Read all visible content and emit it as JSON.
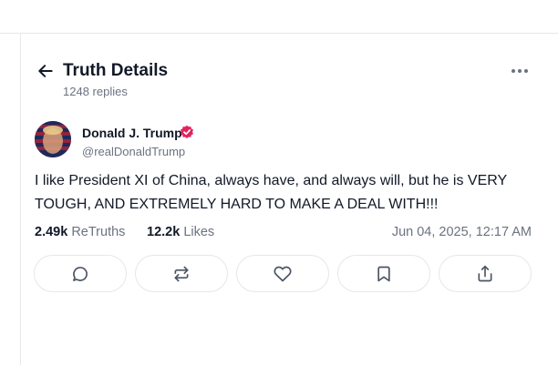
{
  "header": {
    "title": "Truth Details",
    "replies_count": "1248 replies",
    "back_icon": "arrow-left-icon",
    "more_icon": "more-horizontal-icon"
  },
  "post": {
    "author_name": "Donald J. Trump",
    "handle": "@realDonaldTrump",
    "verified_color": "#e0245e",
    "text": "I like President XI of China, always have, and always will, but he is VERY TOUGH, AND EXTREMELY HARD TO MAKE A DEAL WITH!!!",
    "retruths_count": "2.49k",
    "retruths_label": "ReTruths",
    "likes_count": "12.2k",
    "likes_label": "Likes",
    "timestamp": "Jun 04, 2025, 12:17 AM"
  },
  "actions": [
    {
      "icon": "reply-icon"
    },
    {
      "icon": "retruth-icon"
    },
    {
      "icon": "like-icon"
    },
    {
      "icon": "bookmark-icon"
    },
    {
      "icon": "share-icon"
    }
  ],
  "colors": {
    "border": "#e5e7eb",
    "secondary_text": "#6b7280",
    "primary_text": "#111827"
  }
}
